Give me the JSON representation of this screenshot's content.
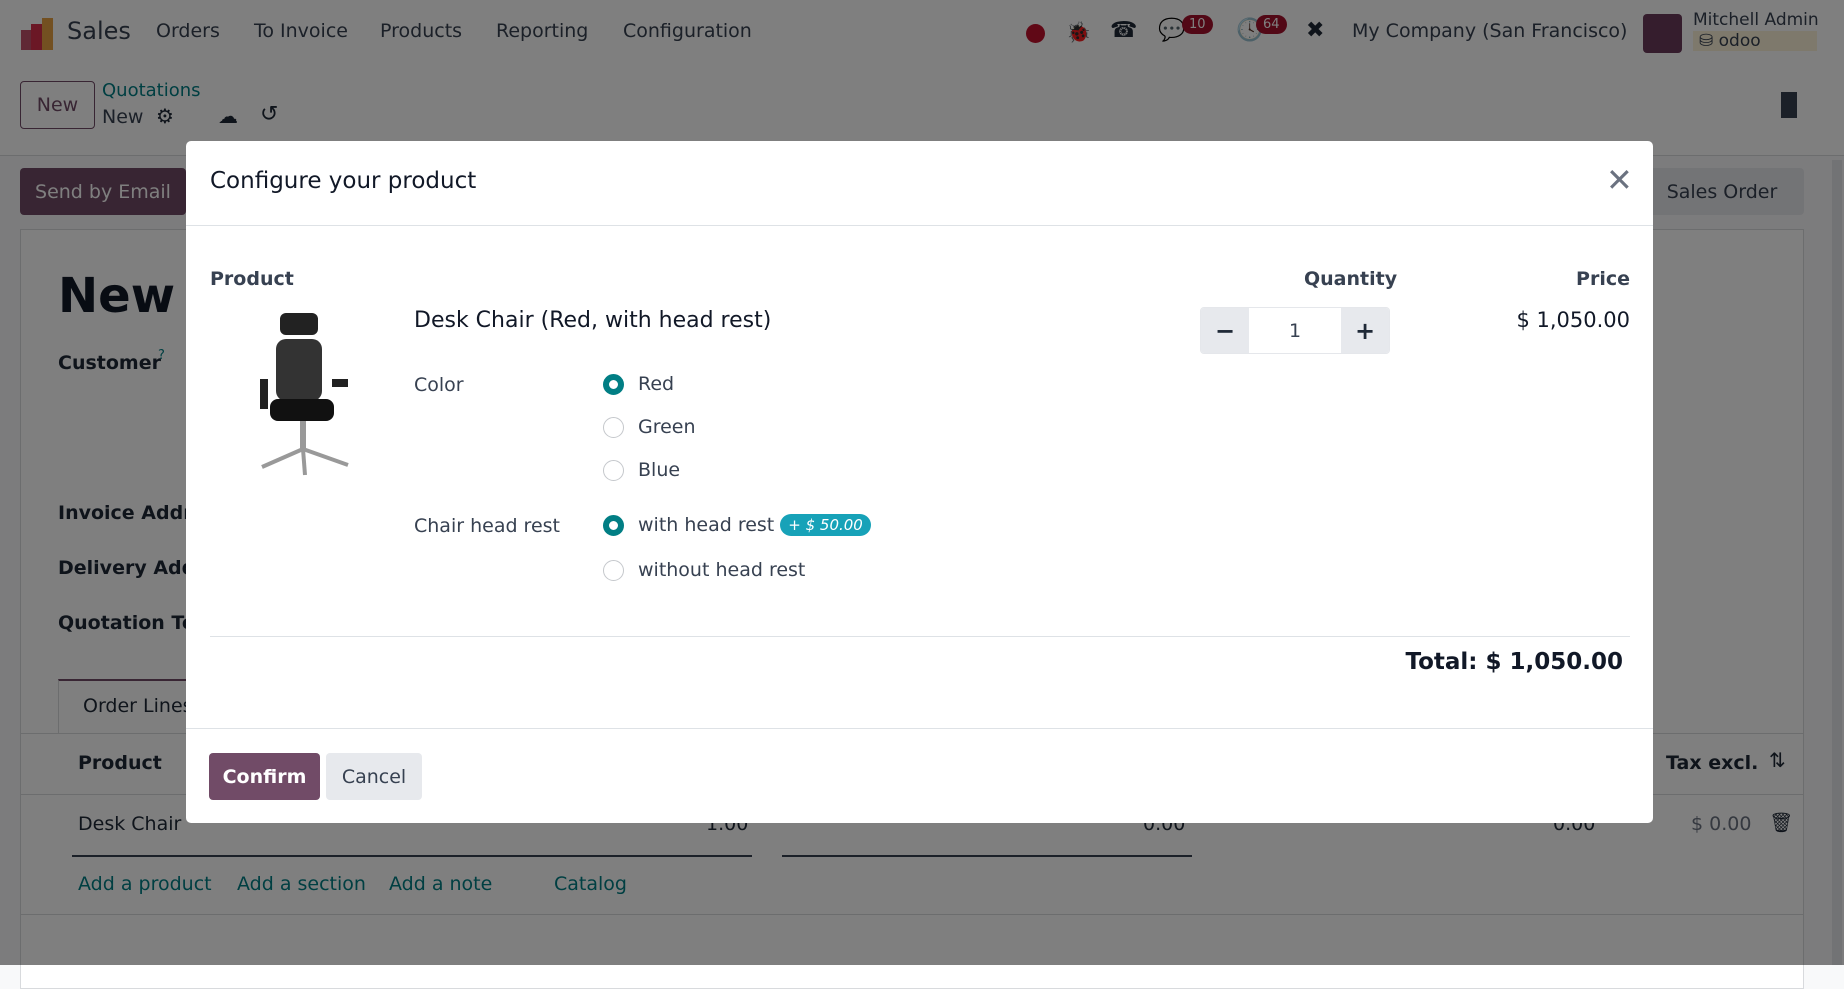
{
  "navbar": {
    "app": "Sales",
    "menu": [
      "Orders",
      "To Invoice",
      "Products",
      "Reporting",
      "Configuration"
    ],
    "chat_badge": "10",
    "activity_badge": "64",
    "company": "My Company (San Francisco)",
    "user": "Mitchell Admin",
    "db": "odoo"
  },
  "control": {
    "new_button": "New",
    "breadcrumb": "Quotations",
    "record": "New"
  },
  "actions": {
    "send_email": "Send by Email",
    "sales_order": "Sales Order"
  },
  "form": {
    "title": "New",
    "customer": "Customer",
    "customer_help": "?",
    "invoice": "Invoice Addre",
    "delivery": "Delivery Addr",
    "terms": "Quotation Te",
    "tab": "Order Lines",
    "col_product": "Product",
    "col_tax": "Tax excl.",
    "row": {
      "product": "Desk Chair",
      "qty": "1.00",
      "price": "0.00",
      "disc": "0.00",
      "subtotal": "$ 0.00"
    },
    "links": [
      "Add a product",
      "Add a section",
      "Add a note",
      "Catalog"
    ]
  },
  "modal": {
    "title": "Configure your product",
    "col_product": "Product",
    "col_quantity": "Quantity",
    "col_price": "Price",
    "product_name": "Desk Chair (Red, with head rest)",
    "quantity": "1",
    "price": "$ 1,050.00",
    "attributes": [
      {
        "name": "Color",
        "options": [
          {
            "label": "Red",
            "selected": true
          },
          {
            "label": "Green",
            "selected": false
          },
          {
            "label": "Blue",
            "selected": false
          }
        ]
      },
      {
        "name": "Chair head rest",
        "options": [
          {
            "label": "with head rest",
            "selected": true,
            "extra": "+ $ 50.00"
          },
          {
            "label": "without head rest",
            "selected": false
          }
        ]
      }
    ],
    "total": "Total: $ 1,050.00",
    "confirm": "Confirm",
    "cancel": "Cancel"
  },
  "colors": {
    "primary": "#714B67",
    "accent": "#017e84",
    "badge_extra": "#17a2b8",
    "notif": "#a5102c"
  }
}
